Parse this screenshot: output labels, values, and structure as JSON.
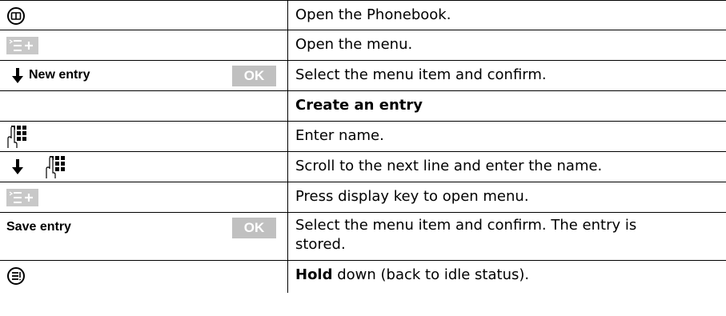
{
  "rows": [
    {
      "instruction": "Open the Phonebook.",
      "left_icon": "phonebook-key-icon"
    },
    {
      "instruction": "Open the menu.",
      "left_icon": "menu-softkey-icon"
    },
    {
      "left_label": "New entry",
      "ok_label": "OK",
      "instruction": "Select the menu item and confirm.",
      "left_icon": "arrow-down-icon"
    },
    {
      "instruction_bold": "Create an entry"
    },
    {
      "instruction": "Enter name.",
      "left_icon": "keypad-icon"
    },
    {
      "instruction": "Scroll to the next line and enter the name.",
      "left_icon": "arrow-down-keypad-icon"
    },
    {
      "instruction": "Press display key to open menu.",
      "left_icon": "menu-softkey-icon"
    },
    {
      "left_label": "Save entry",
      "ok_label": "OK",
      "instruction_line1": "Select the menu item and confirm. The entry is",
      "instruction_line2": "stored."
    },
    {
      "instruction_bold": "Hold",
      "instruction_rest": " down (back to idle status).",
      "left_icon": "end-call-key-icon"
    }
  ]
}
